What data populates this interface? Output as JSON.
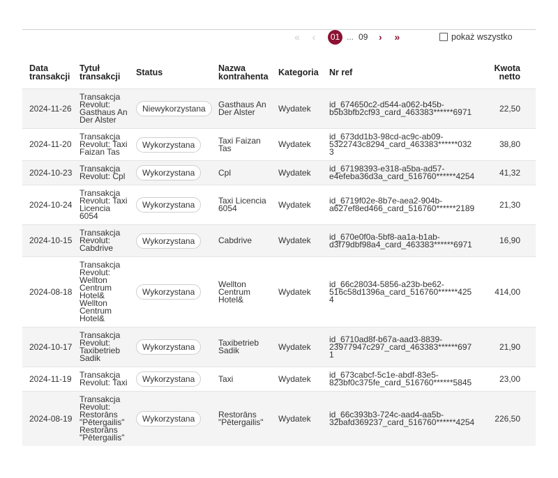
{
  "pagination": {
    "first_icon": "double-chevron-left-icon",
    "prev_icon": "chevron-left-icon",
    "current_page": "01",
    "ellipsis": "...",
    "last_page": "09",
    "next_icon": "chevron-right-icon",
    "last_icon": "double-chevron-right-icon",
    "first_glyph": "«",
    "prev_glyph": "‹",
    "next_glyph": "›",
    "last_glyph": "»"
  },
  "show_all": {
    "label": "pokaż wszystko",
    "checked": false
  },
  "colors": {
    "accent": "#8b1232",
    "row_alt": "#f4f4f4"
  },
  "table": {
    "headers": {
      "date": "Data transakcji",
      "title": "Tytuł transakcji",
      "status": "Status",
      "counterparty": "Nazwa kontrahenta",
      "category": "Kategoria",
      "ref": "Nr ref",
      "amount": "Kwota netto"
    },
    "rows": [
      {
        "date": "2024-11-26",
        "title": "Transakcja Revolut: Gasthaus An Der Alster",
        "status": "Niewykorzystana",
        "counterparty": "Gasthaus An Der Alster",
        "category": "Wydatek",
        "ref": "id_674650c2-d544-a062-b45b-b5b3bfb2cf93_card_463383******6971",
        "amount": "22,50"
      },
      {
        "date": "2024-11-20",
        "title": "Transakcja Revolut: Taxi Faizan Tas",
        "status": "Wykorzystana",
        "counterparty": "Taxi Faizan Tas",
        "category": "Wydatek",
        "ref": "id_673dd1b3-98cd-ac9c-ab09-5322743c8294_card_463383******0323",
        "amount": "38,80"
      },
      {
        "date": "2024-10-23",
        "title": "Transakcja Revolut: Cpl",
        "status": "Wykorzystana",
        "counterparty": "Cpl",
        "category": "Wydatek",
        "ref": "id_67198393-e318-a5ba-ad57-e4efeba36d3a_card_516760******4254",
        "amount": "41,32"
      },
      {
        "date": "2024-10-24",
        "title": "Transakcja Revolut: Taxi Licencia 6054",
        "status": "Wykorzystana",
        "counterparty": "Taxi Licencia 6054",
        "category": "Wydatek",
        "ref": "id_6719f02e-8b7e-aea2-904b-a627ef8ed466_card_516760******2189",
        "amount": "21,30"
      },
      {
        "date": "2024-10-15",
        "title": "Transakcja Revolut: Cabdrive",
        "status": "Wykorzystana",
        "counterparty": "Cabdrive",
        "category": "Wydatek",
        "ref": "id_670e0f0a-5bf8-aa1a-b1ab-d3f79dbf98a4_card_463383******6971",
        "amount": "16,90"
      },
      {
        "date": "2024-08-18",
        "title": "Transakcja Revolut: Wellton Centrum Hotel& Wellton Centrum Hotel&",
        "status": "Wykorzystana",
        "counterparty": "Wellton Centrum Hotel&",
        "category": "Wydatek",
        "ref": "id_66c28034-5856-a23b-be62-516c58d1396a_card_516760******4254",
        "amount": "414,00"
      },
      {
        "date": "2024-10-17",
        "title": "Transakcja Revolut: Taxibetrieb Sadik",
        "status": "Wykorzystana",
        "counterparty": "Taxibetrieb Sadik",
        "category": "Wydatek",
        "ref": "id_6710ad8f-b67a-aad3-8839-23977947c297_card_463383******6971",
        "amount": "21,90"
      },
      {
        "date": "2024-11-19",
        "title": "Transakcja Revolut: Taxi",
        "status": "Wykorzystana",
        "counterparty": "Taxi",
        "category": "Wydatek",
        "ref": "id_673cabcf-5c1e-abdf-83e5-823bf0c375fe_card_516760******5845",
        "amount": "23,00"
      },
      {
        "date": "2024-08-19",
        "title": "Transakcja Revolut: Restorāns \"Pētergailis\" Restorāns \"Pētergailis\"",
        "status": "Wykorzystana",
        "counterparty": "Restorāns \"Pētergailis\"",
        "category": "Wydatek",
        "ref": "id_66c393b3-724c-aad4-aa5b-32bafd369237_card_516760******4254",
        "amount": "226,50"
      }
    ]
  }
}
